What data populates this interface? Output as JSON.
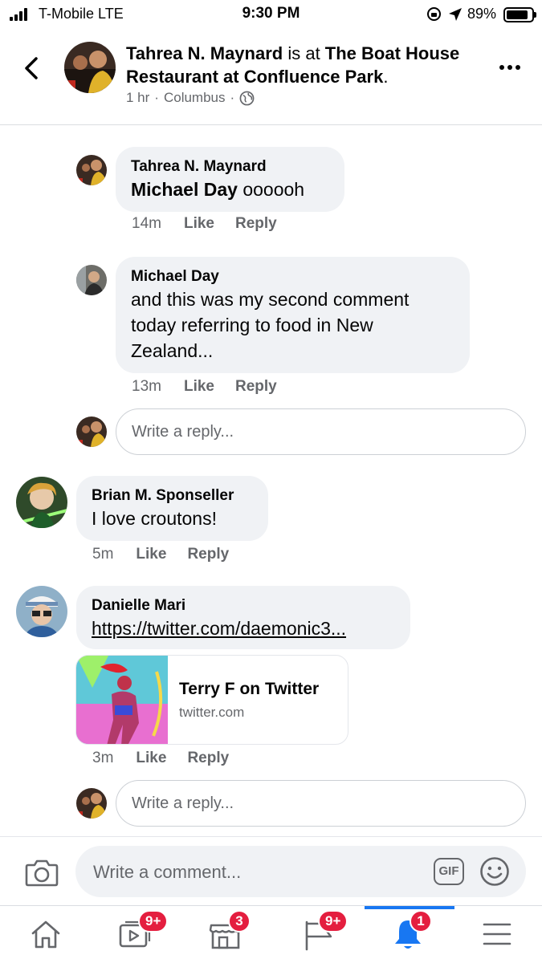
{
  "status_bar": {
    "carrier": "T-Mobile  LTE",
    "time": "9:30 PM",
    "battery": "89%"
  },
  "header": {
    "author": "Tahrea N. Maynard",
    "joiner": " is at ",
    "place": "The Boat House Restaurant at Confluence Park",
    "period": ".",
    "time": "1 hr",
    "separator": "·",
    "location": "Columbus"
  },
  "comments": [
    {
      "name": "Tahrea N. Maynard",
      "mention": "Michael Day",
      "text": " oooooh",
      "time": "14m",
      "like": "Like",
      "reply": "Reply"
    },
    {
      "name": "Michael Day",
      "text": "and this was my second comment today referring to food in New Zealand...",
      "time": "13m",
      "like": "Like",
      "reply": "Reply"
    },
    {
      "name": "Brian M. Sponseller",
      "text": "I love croutons!",
      "time": "5m",
      "like": "Like",
      "reply": "Reply"
    },
    {
      "name": "Danielle Mari",
      "link": "https://twitter.com/daemonic3...",
      "card_title": "Terry F on Twitter",
      "card_domain": "twitter.com",
      "time": "3m",
      "like": "Like",
      "reply": "Reply"
    }
  ],
  "reply_placeholder": "Write a reply...",
  "composer": {
    "placeholder": "Write a comment...",
    "gif": "GIF"
  },
  "tab_bar": {
    "items": [
      {
        "icon": "home-icon",
        "badge": ""
      },
      {
        "icon": "watch-icon",
        "badge": "9+"
      },
      {
        "icon": "marketplace-icon",
        "badge": "3"
      },
      {
        "icon": "pages-flag-icon",
        "badge": "9+"
      },
      {
        "icon": "notifications-bell-icon",
        "badge": "1",
        "active": true
      },
      {
        "icon": "menu-icon",
        "badge": ""
      }
    ]
  },
  "colors": {
    "accent": "#1877f2",
    "badge": "#e41e3f",
    "bubble": "#f0f2f5",
    "secondary_text": "#65676b"
  }
}
